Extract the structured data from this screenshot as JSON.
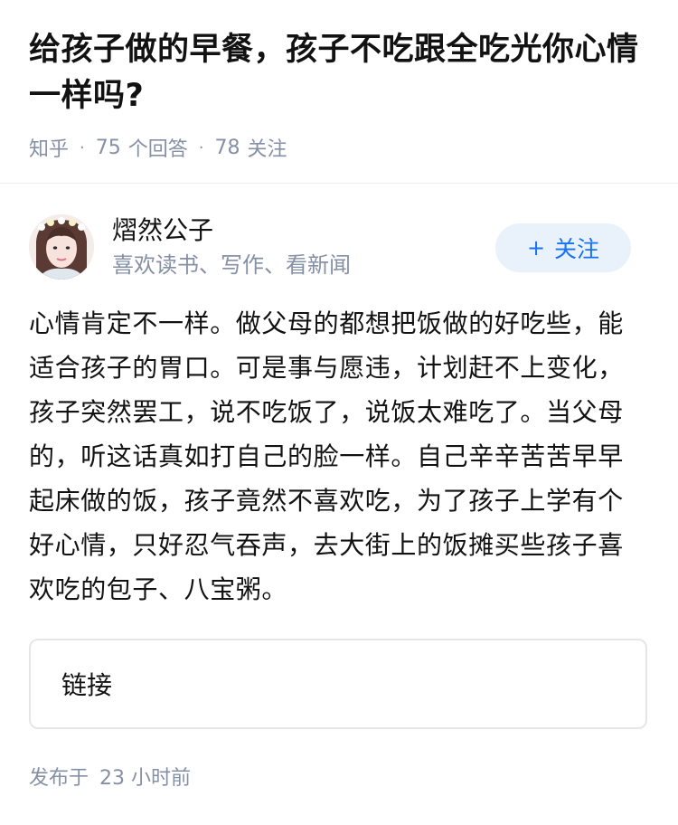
{
  "question": {
    "title": "给孩子做的早餐，孩子不吃跟全吃光你心情一样吗?",
    "source": "知乎",
    "answer_count": "75",
    "answer_label": "个回答",
    "follow_count": "78",
    "follow_label": "关注"
  },
  "author": {
    "name": "熠然公子",
    "bio": "喜欢读书、写作、看新闻",
    "follow_button": "关注",
    "follow_icon": "plus-icon"
  },
  "answer": {
    "text": "心情肯定不一样。做父母的都想把饭做的好吃些，能适合孩子的胃口。可是事与愿违，计划赶不上变化，孩子突然罢工，说不吃饭了，说饭太难吃了。当父母的，听这话真如打自己的脸一样。自己辛辛苦苦早早起床做的饭，孩子竟然不喜欢吃，为了孩子上学有个好心情，只好忍气吞声，去大街上的饭摊买些孩子喜欢吃的包子、八宝粥。"
  },
  "link_card": {
    "label": "链接"
  },
  "footer": {
    "prefix": "发布于",
    "time": "23 小时前"
  },
  "colors": {
    "accent": "#1772f6",
    "follow_bg": "#e9f2fb",
    "meta_gray": "#8590a6"
  }
}
